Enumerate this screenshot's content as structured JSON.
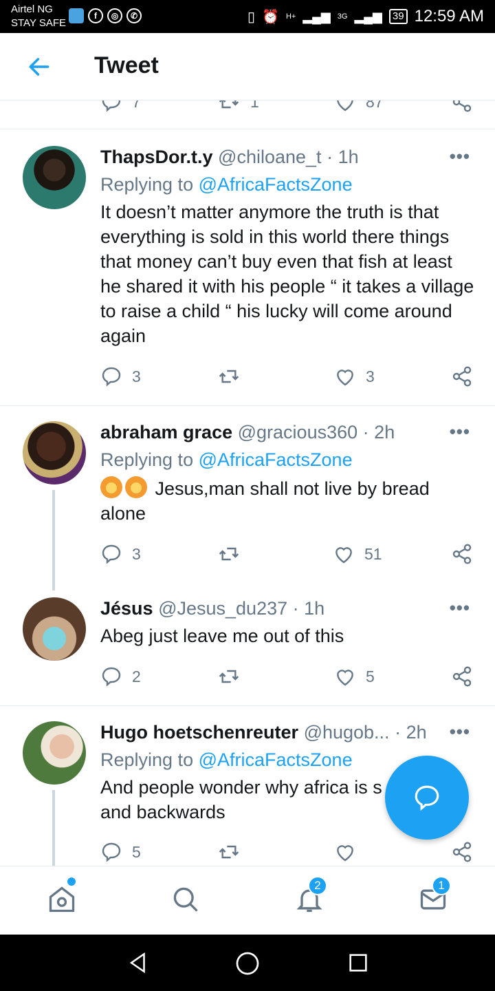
{
  "status_bar": {
    "carrier": "Airtel NG",
    "carrier_sub": "STAY SAFE",
    "net1": "H+",
    "net2": "3G",
    "battery": "39",
    "time": "12:59 AM"
  },
  "header": {
    "title": "Tweet"
  },
  "partial_row": {
    "replies": "7",
    "retweets": "1",
    "likes": "87"
  },
  "tweets": [
    {
      "name": "ThapsDor.t.y",
      "handle": "@chiloane_t",
      "separator": "·",
      "time": "1h",
      "replying_prefix": "Replying to",
      "replying_to": "@AfricaFactsZone",
      "text": "It doesn’t matter anymore the truth is that everything is sold in this world there things that money can’t buy even that fish at least he shared it with his people “ it takes a village to raise a child “ his lucky will come around again",
      "replies": "3",
      "retweets": "",
      "likes": "3"
    },
    {
      "name": "abraham grace",
      "handle": "@gracious360",
      "separator": "·",
      "time": "2h",
      "replying_prefix": "Replying to",
      "replying_to": "@AfricaFactsZone",
      "text": "Jesus,man shall not live by bread alone",
      "replies": "3",
      "retweets": "",
      "likes": "51"
    },
    {
      "name": "Jésus",
      "handle": "@Jesus_du237",
      "separator": "·",
      "time": "1h",
      "text": "Abeg just leave me out of this",
      "replies": "2",
      "retweets": "",
      "likes": "5"
    },
    {
      "name": "Hugo hoetschenreuter",
      "handle": "@hugob...",
      "separator": "·",
      "time": "2h",
      "replying_prefix": "Replying to",
      "replying_to": "@AfricaFactsZone",
      "text": "And people wonder why africa is s and backwards",
      "replies": "5",
      "retweets": "",
      "likes": ""
    }
  ],
  "more_label": "•••",
  "tab_bar": {
    "notifications_badge": "2",
    "messages_badge": "1"
  },
  "colors": {
    "accent": "#1da1f2",
    "muted": "#657786",
    "divider": "#e6ecf0"
  }
}
